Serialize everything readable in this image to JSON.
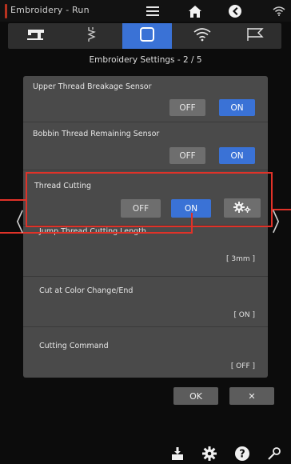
{
  "status_bar": {
    "title": "Embroidery - Run",
    "accent_color": "#b8321f",
    "icons": [
      "menu-icon",
      "home-icon",
      "wifi-icon"
    ]
  },
  "tabs": [
    {
      "name": "sewing-machine-tab",
      "icon": "sewing-machine-icon",
      "active": false
    },
    {
      "name": "stitch-tab",
      "icon": "stitch-icon",
      "active": false
    },
    {
      "name": "frame-tab",
      "icon": "frame-icon",
      "active": true
    },
    {
      "name": "wireless-tab",
      "icon": "wireless-icon",
      "active": false
    },
    {
      "name": "flag-tab",
      "icon": "flag-icon",
      "active": false
    }
  ],
  "header": {
    "title": "Embroidery Settings  -  2 / 5"
  },
  "settings": {
    "upper_thread": {
      "label": "Upper Thread Breakage Sensor",
      "off_label": "OFF",
      "on_label": "ON",
      "selected": "ON"
    },
    "bobbin_thread": {
      "label": "Bobbin Thread Remaining Sensor",
      "off_label": "OFF",
      "on_label": "ON",
      "selected": "ON"
    },
    "thread_cutting": {
      "label": "Thread Cutting",
      "off_label": "OFF",
      "on_label": "ON",
      "selected": "ON",
      "gear_icon": "gear-icon"
    },
    "jump_thread": {
      "label": "Jump Thread Cutting Length",
      "value": "[ 3mm ]"
    },
    "cut_color_change": {
      "label": "Cut at Color Change/End",
      "value": "[ ON ]"
    },
    "cutting_command": {
      "label": "Cutting Command",
      "value": "[ OFF ]"
    }
  },
  "dialog": {
    "ok_label": "OK",
    "close_label": "✕"
  },
  "nav": {
    "prev_label": "〈",
    "next_label": "〉"
  },
  "bottom_bar": {
    "icons": [
      "download-icon",
      "settings-icon",
      "help-icon",
      "tools-icon"
    ]
  },
  "colors": {
    "accent_blue": "#3a72d6",
    "annotation_red": "#e03228",
    "panel_gray": "#4a4a4a",
    "button_gray": "#6e6e6e"
  }
}
